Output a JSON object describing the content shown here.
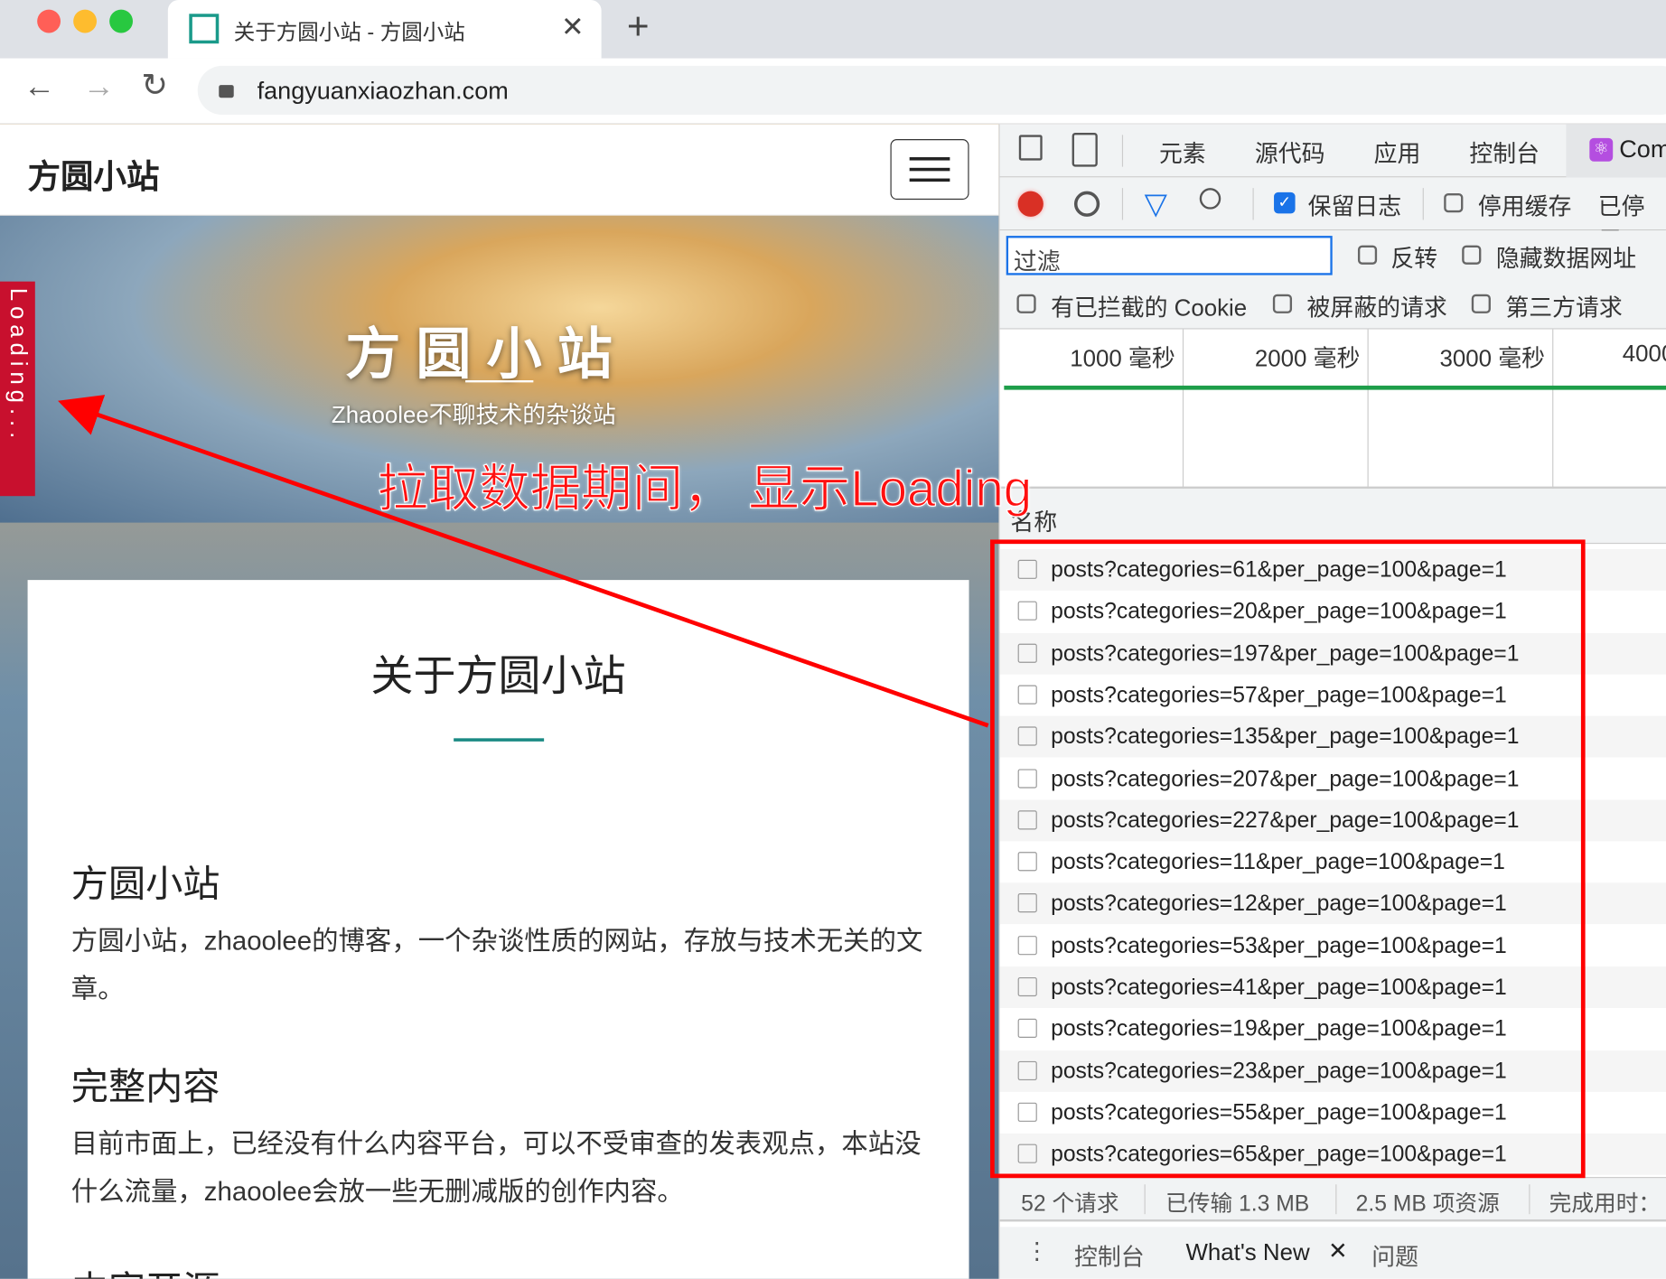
{
  "browser": {
    "tab_title": "关于方圆小站 - 方圆小站",
    "url": "fangyuanxiaozhan.com",
    "traffic_lights": [
      "#ff5f57",
      "#febc2e",
      "#28c840"
    ]
  },
  "site": {
    "brand": "方圆小站",
    "hero_title": "方 圆 小 站",
    "hero_subtitle": "Zhaoolee不聊技术的杂谈站",
    "loading_tab": "Loading...",
    "page_title": "关于方圆小站",
    "sections": [
      {
        "heading": "方圆小站",
        "text": "方圆小站，zhaoolee的博客，一个杂谈性质的网站，存放与技术无关的文章。"
      },
      {
        "heading": "完整内容",
        "text": "目前市面上，已经没有什么内容平台，可以不受审查的发表观点，本站没什么流量，zhaoolee会放一些无删减版的创作内容。"
      },
      {
        "heading": "内容开源",
        "text": ""
      }
    ],
    "accent": "#1a8a84"
  },
  "annotation": {
    "text": "拉取数据期间， 显示Loading",
    "color": "#ff0000"
  },
  "devtools": {
    "tabs": [
      "元素",
      "源代码",
      "应用",
      "控制台",
      "Com"
    ],
    "preserve_log": "保留日志",
    "preserve_log_checked": true,
    "disable_cache": "停用缓存",
    "disabled_trunc": "已停用",
    "filter_placeholder": "过滤",
    "invert": "反转",
    "hide_data_urls": "隐藏数据网址",
    "blocked_cookies": "有已拦截的 Cookie",
    "blocked_requests": "被屏蔽的请求",
    "third_party": "第三方请求",
    "timeline_ticks": [
      "1000 毫秒",
      "2000 毫秒",
      "3000 毫秒",
      "4000"
    ],
    "name_header": "名称",
    "requests": [
      "posts?categories=61&per_page=100&page=1",
      "posts?categories=20&per_page=100&page=1",
      "posts?categories=197&per_page=100&page=1",
      "posts?categories=57&per_page=100&page=1",
      "posts?categories=135&per_page=100&page=1",
      "posts?categories=207&per_page=100&page=1",
      "posts?categories=227&per_page=100&page=1",
      "posts?categories=11&per_page=100&page=1",
      "posts?categories=12&per_page=100&page=1",
      "posts?categories=53&per_page=100&page=1",
      "posts?categories=41&per_page=100&page=1",
      "posts?categories=19&per_page=100&page=1",
      "posts?categories=23&per_page=100&page=1",
      "posts?categories=55&per_page=100&page=1",
      "posts?categories=65&per_page=100&page=1"
    ],
    "status": {
      "requests": "52 个请求",
      "transferred": "已传输 1.3 MB",
      "resources": "2.5 MB 项资源",
      "finish": "完成用时："
    },
    "drawer": {
      "console": "控制台",
      "whats_new": "What's New",
      "issues": "问题"
    }
  }
}
